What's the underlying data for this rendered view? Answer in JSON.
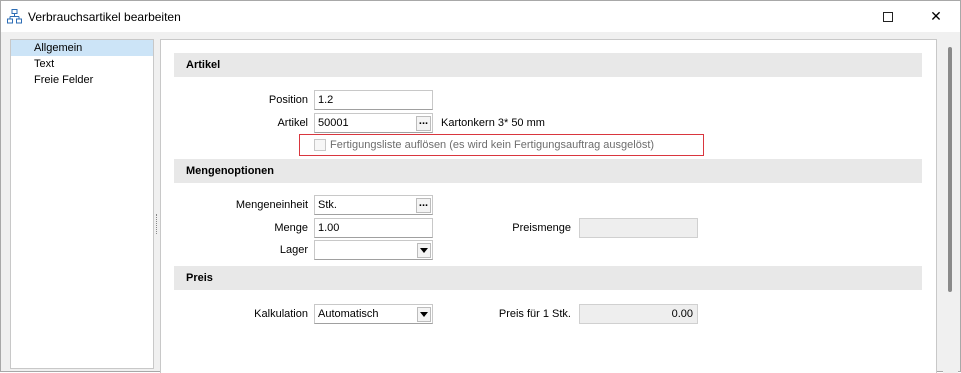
{
  "window": {
    "title": "Verbrauchsartikel bearbeiten",
    "maximize_icon": "maximize-icon",
    "close_glyph": "✕"
  },
  "sidebar": {
    "items": [
      {
        "label": "Allgemein",
        "selected": true
      },
      {
        "label": "Text",
        "selected": false
      },
      {
        "label": "Freie Felder",
        "selected": false
      }
    ]
  },
  "sections": {
    "artikel": "Artikel",
    "mengenoptionen": "Mengenoptionen",
    "preis": "Preis"
  },
  "artikel": {
    "position_label": "Position",
    "position_value": "1.2",
    "artikel_label": "Artikel",
    "artikel_value": "50001",
    "ellipsis": "...",
    "artikel_description": "Kartonkern 3* 50 mm",
    "checkbox_label": "Fertigungsliste auflösen (es wird kein Fertigungsauftrag ausgelöst)",
    "checkbox_checked": false
  },
  "mengen": {
    "einheit_label": "Mengeneinheit",
    "einheit_value": "Stk.",
    "menge_label": "Menge",
    "menge_value": "1.00",
    "preismenge_label": "Preismenge",
    "preismenge_value": "",
    "lager_label": "Lager",
    "lager_value": ""
  },
  "preis": {
    "kalkulation_label": "Kalkulation",
    "kalkulation_value": "Automatisch",
    "preis_fuer_label": "Preis für 1 Stk.",
    "preis_fuer_value": "0.00"
  },
  "colors": {
    "selected_bg": "#cce4f7",
    "highlight_border": "#d9363e",
    "section_bg": "#e8e8e8"
  }
}
